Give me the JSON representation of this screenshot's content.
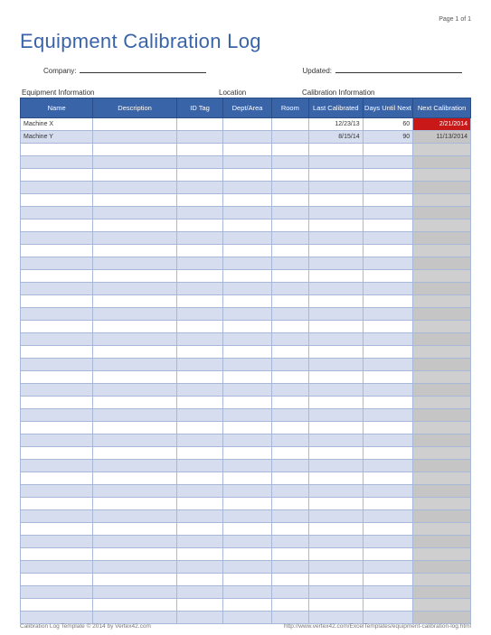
{
  "page_number": "Page 1 of 1",
  "title": "Equipment Calibration Log",
  "meta": {
    "company_label": "Company:",
    "updated_label": "Updated:"
  },
  "sections": {
    "equipment": "Equipment Information",
    "location": "Location",
    "calibration": "Calibration Information"
  },
  "columns": {
    "name": "Name",
    "description": "Description",
    "id_tag": "ID Tag",
    "dept_area": "Dept/Area",
    "room": "Room",
    "last_calibrated": "Last Calibrated",
    "days_until_next": "Days Until Next",
    "next_calibration": "Next Calibration"
  },
  "rows": [
    {
      "name": "Machine X",
      "description": "",
      "id_tag": "",
      "dept_area": "",
      "room": "",
      "last_calibrated": "12/23/13",
      "days_until_next": "60",
      "next_calibration": "2/21/2014",
      "overdue": true
    },
    {
      "name": "Machine Y",
      "description": "",
      "id_tag": "",
      "dept_area": "",
      "room": "",
      "last_calibrated": "8/15/14",
      "days_until_next": "90",
      "next_calibration": "11/13/2014",
      "overdue": false
    }
  ],
  "empty_row_count": 38,
  "footer": {
    "left": "Calibration Log Template © 2014 by Vertex42.com",
    "right": "http://www.vertex42.com/ExcelTemplates/equipment-calibration-log.html"
  }
}
